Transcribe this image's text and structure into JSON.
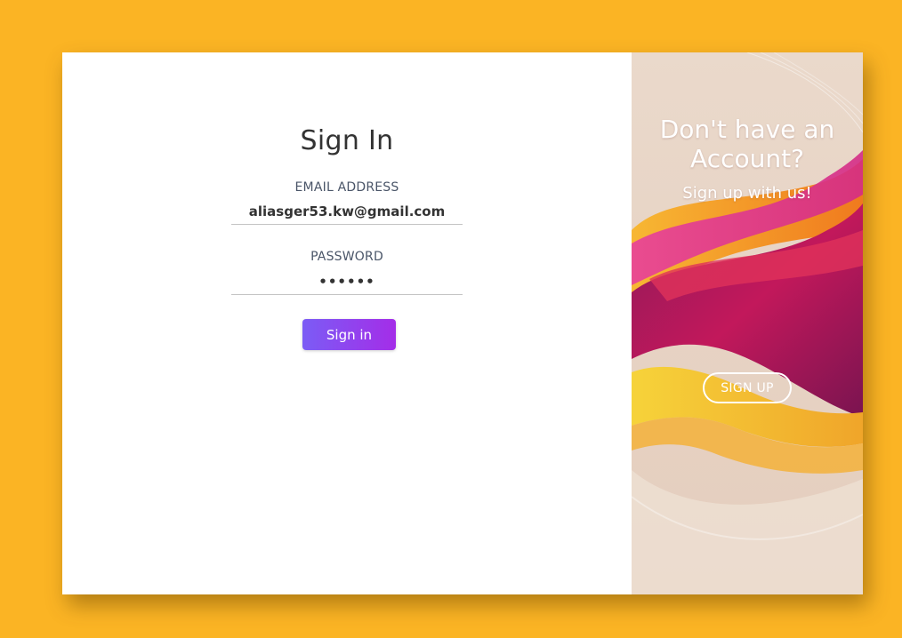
{
  "signin": {
    "title": "Sign In",
    "email_label": "EMAIL ADDRESS",
    "email_value": "aliasger53.kw@gmail.com",
    "password_label": "PASSWORD",
    "password_value": "••••••",
    "submit_label": "Sign in"
  },
  "promo": {
    "title": "Don't have an Account?",
    "subtitle": "Sign up with us!",
    "signup_label": "SIGN UP"
  },
  "colors": {
    "page_background": "#fbb424",
    "button_gradient_start": "#7b5cf5",
    "button_gradient_end": "#a42de8",
    "panel_magenta": "#c2185b",
    "panel_orange": "#f5a623"
  }
}
